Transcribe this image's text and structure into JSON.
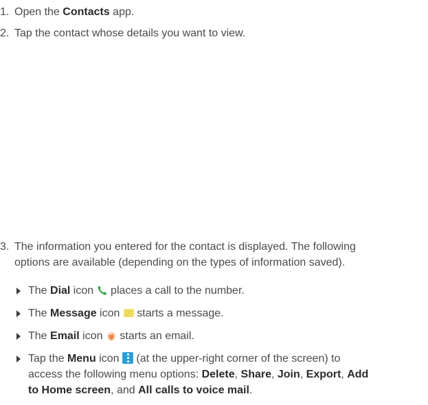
{
  "steps": [
    {
      "num": "1.",
      "parts": [
        "Open the ",
        "Contacts",
        " app."
      ]
    },
    {
      "num": "2.",
      "text": "Tap the contact whose details you want to view."
    },
    {
      "num": "3.",
      "line1": "The information you entered for the contact is displayed. The following",
      "line2": "options are available (depending on the types of information saved)."
    }
  ],
  "bullets": {
    "dial": {
      "pre": "The ",
      "bold": "Dial",
      "post1": " icon ",
      "post2": " places a call to the number.",
      "icon": "phone-icon"
    },
    "message": {
      "pre": "The ",
      "bold": "Message",
      "post1": " icon ",
      "post2": " starts a message.",
      "icon": "message-icon"
    },
    "email": {
      "pre": "The ",
      "bold": "Email",
      "post1": " icon ",
      "post2": " starts an email.",
      "icon": "email-icon"
    },
    "menu": {
      "pre": "Tap the ",
      "bold": "Menu",
      "post1": " icon ",
      "post2": " (at the upper-right corner of the screen) to",
      "line2": "access the following menu options: ",
      "opt_delete": "Delete",
      "sep1": ", ",
      "opt_share": "Share",
      "sep2": ", ",
      "opt_join": "Join",
      "sep3": ", ",
      "opt_export": "Export",
      "sep4": ", ",
      "opt_add": "Add",
      "opt_add2": "to Home screen",
      "sep5": ", and ",
      "opt_voicemail": "All calls to voice mail",
      "end": ".",
      "icon": "menu-icon"
    }
  },
  "colors": {
    "text": "#4a4a4a",
    "bold": "#2a2a2a",
    "phone_icon": "#3aa84a",
    "message_icon": "#f3df6a",
    "email_icon": "#f0a050",
    "menu_icon": "#2c9fd8"
  }
}
